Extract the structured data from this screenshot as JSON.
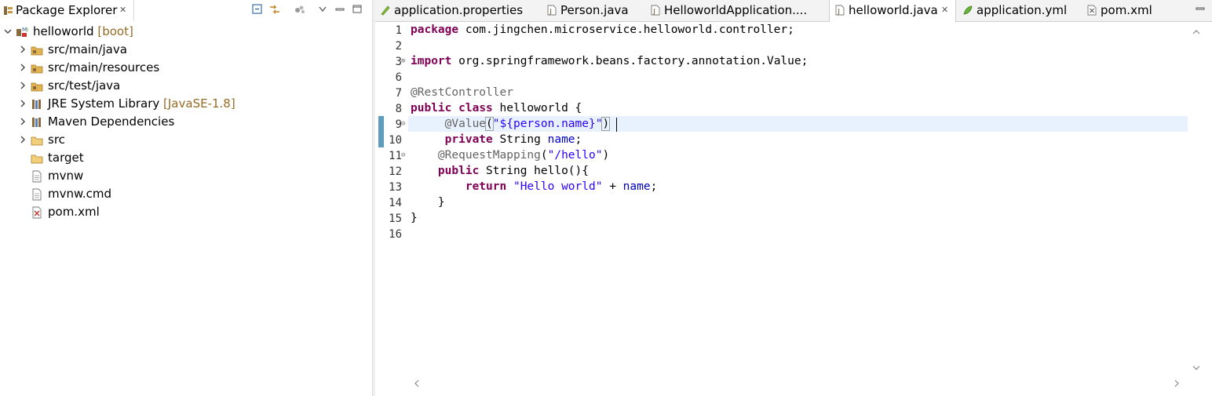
{
  "package_explorer": {
    "title": "Package Explorer",
    "tree": [
      {
        "label": "helloworld",
        "decoration": "[boot]",
        "icon": "spring-project-icon",
        "expanded": true
      },
      {
        "label": "src/main/java",
        "decoration": "",
        "icon": "source-folder-icon",
        "expanded": false
      },
      {
        "label": "src/main/resources",
        "decoration": "",
        "icon": "source-folder-icon",
        "expanded": false
      },
      {
        "label": "src/test/java",
        "decoration": "",
        "icon": "source-folder-icon",
        "expanded": false
      },
      {
        "label": "JRE System Library",
        "decoration": "[JavaSE-1.8]",
        "icon": "library-icon",
        "expanded": false
      },
      {
        "label": "Maven Dependencies",
        "decoration": "",
        "icon": "library-icon",
        "expanded": false
      },
      {
        "label": "src",
        "decoration": "",
        "icon": "folder-icon",
        "expanded": false
      },
      {
        "label": "target",
        "decoration": "",
        "icon": "folder-icon",
        "expanded": null
      },
      {
        "label": "mvnw",
        "decoration": "",
        "icon": "file-icon",
        "expanded": null
      },
      {
        "label": "mvnw.cmd",
        "decoration": "",
        "icon": "file-icon",
        "expanded": null
      },
      {
        "label": "pom.xml",
        "decoration": "",
        "icon": "xml-file-icon",
        "expanded": null
      }
    ]
  },
  "editor": {
    "tabs": [
      {
        "label": "application.properties",
        "icon": "properties-file-icon",
        "active": false
      },
      {
        "label": "Person.java",
        "icon": "java-file-icon",
        "active": false
      },
      {
        "label": "HelloworldApplication....",
        "icon": "java-file-icon",
        "active": false
      },
      {
        "label": "helloworld.java",
        "icon": "java-file-icon",
        "active": true
      },
      {
        "label": "application.yml",
        "icon": "yml-file-icon",
        "active": false
      },
      {
        "label": "pom.xml",
        "icon": "xml-file-icon",
        "active": false
      }
    ],
    "line_numbers": [
      "1",
      "2",
      "3",
      "6",
      "7",
      "8",
      "9",
      "10",
      "11",
      "12",
      "13",
      "14",
      "15",
      "16"
    ],
    "code": {
      "l1_kw": "package",
      "l1_rest": " com.jingchen.microservice.helloworld.controller;",
      "l3_kw": "import",
      "l3_rest": " org.springframework.beans.factory.annotation.Value;",
      "l7_ann": "@RestController",
      "l8_kw1": "public",
      "l8_kw2": "class",
      "l8_rest": " helloworld {",
      "l9_indent": "     ",
      "l9_ann": "@Value",
      "l9_open": "(",
      "l9_str": "\"${person.name}\"",
      "l9_close": ")",
      "l10_indent": "     ",
      "l10_kw": "private",
      "l10_mid": " String ",
      "l10_fld": "name",
      "l10_end": ";",
      "l11_indent": "    ",
      "l11_ann": "@RequestMapping",
      "l11_open": "(",
      "l11_str": "\"/hello\"",
      "l11_close": ")",
      "l12_indent": "    ",
      "l12_kw": "public",
      "l12_rest": " String hello(){",
      "l13_indent": "        ",
      "l13_kw": "return",
      "l13_sp": " ",
      "l13_str": "\"Hello world\"",
      "l13_mid": " + ",
      "l13_fld": "name",
      "l13_end": ";",
      "l14": "    }",
      "l15": "}"
    }
  },
  "colors": {
    "keyword": "#7f0055",
    "annotation": "#646464",
    "string": "#2a00ff",
    "field": "#0000c0",
    "current_line": "#e8f2fe",
    "change_marker": "#5f9bbd"
  }
}
